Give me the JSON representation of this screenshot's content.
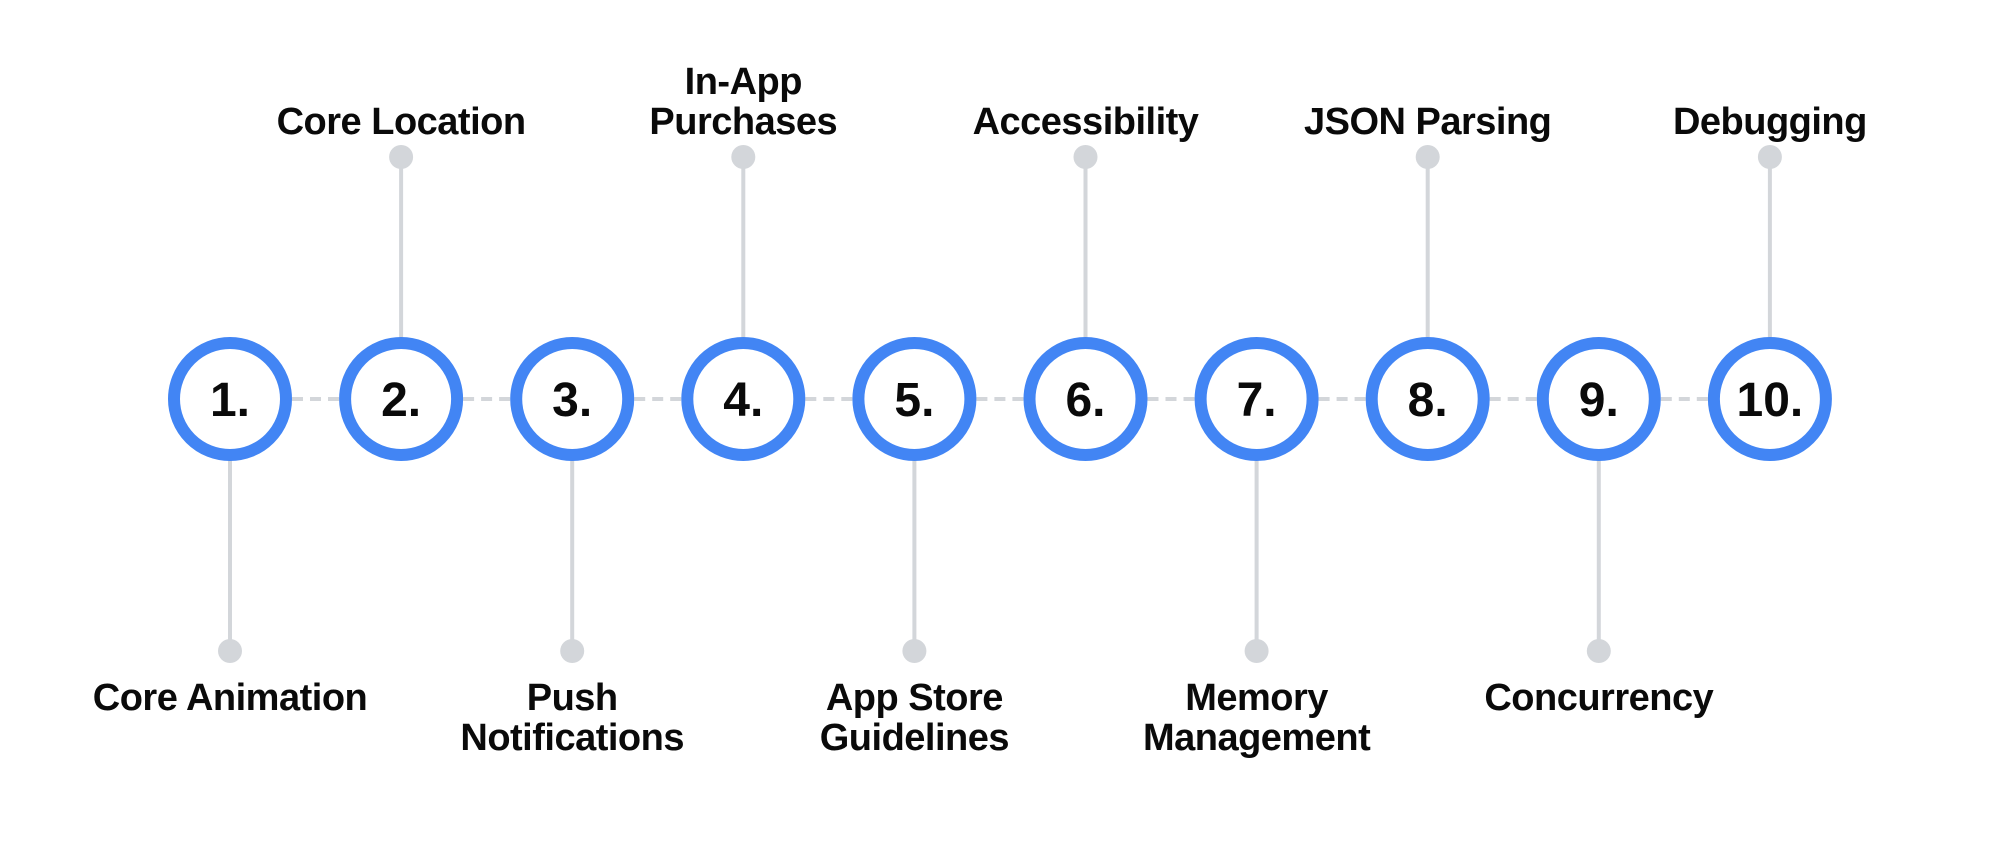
{
  "diagram": {
    "type": "numbered-timeline",
    "ring_color": "#4285f4",
    "connector_color": "#d3d6da",
    "text_color": "#0a0a0a",
    "steps": [
      {
        "number": "1.",
        "label": "Core Animation",
        "side": "bottom"
      },
      {
        "number": "2.",
        "label": "Core Location",
        "side": "top"
      },
      {
        "number": "3.",
        "label": "Push Notifications",
        "side": "bottom"
      },
      {
        "number": "4.",
        "label": "In-App Purchases",
        "side": "top"
      },
      {
        "number": "5.",
        "label": "App Store Guidelines",
        "side": "bottom"
      },
      {
        "number": "6.",
        "label": "Accessibility",
        "side": "top"
      },
      {
        "number": "7.",
        "label": "Memory Management",
        "side": "bottom"
      },
      {
        "number": "8.",
        "label": "JSON Parsing",
        "side": "top"
      },
      {
        "number": "9.",
        "label": "Concurrency",
        "side": "bottom"
      },
      {
        "number": "10.",
        "label": "Debugging",
        "side": "top"
      }
    ]
  }
}
